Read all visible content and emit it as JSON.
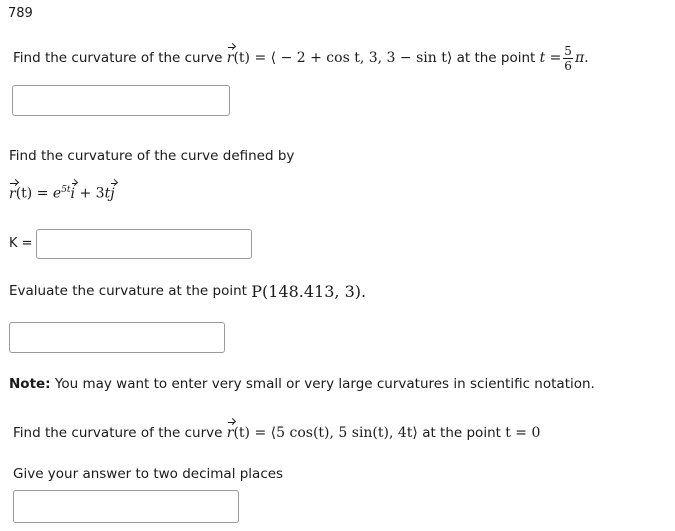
{
  "problem_number": "789",
  "q1": {
    "prompt": "Find the curvature of the curve",
    "lhs_name": "r",
    "lhs_arg": "(t)",
    "eq": "=",
    "rhs": "⟨ − 2 + cos t, 3, 3 − sin t⟩",
    "at_point": "at the point",
    "t_var": "t",
    "t_eq": "=",
    "frac_num": "5",
    "frac_den": "6",
    "pi": "π."
  },
  "q2": {
    "prompt": "Find the curvature of the curve defined by",
    "def_r": "r",
    "def_arg": "(t)",
    "def_eq": "=",
    "def_e": "e",
    "def_exp": "5t",
    "def_i": "i",
    "def_plus": "+ 3",
    "def_t": "t",
    "def_j": "j",
    "k_label": "K =",
    "eval_prompt": "Evaluate the curvature at the point",
    "point": "P(148.413, 3)."
  },
  "note": {
    "label": "Note:",
    "text": "You may want to enter very small or very large curvatures in scientific notation."
  },
  "q3": {
    "prompt": "Find the curvature of the curve",
    "lhs_name": "r",
    "lhs_arg": "(t)",
    "eq": "=",
    "rhs": "⟨5 cos(t), 5 sin(t), 4t⟩",
    "at_point": "at the point",
    "t_expr": "t = 0",
    "instruction": "Give your answer to two decimal places"
  },
  "inputs": {
    "q1_answer": "",
    "k_answer": "",
    "eval_answer": "",
    "q3_answer": ""
  }
}
